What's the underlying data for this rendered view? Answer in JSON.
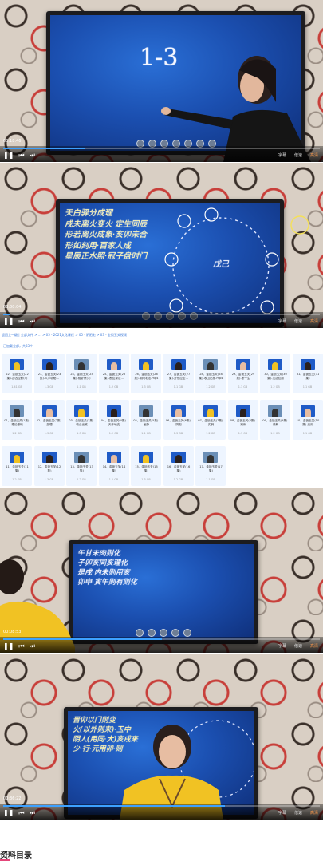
{
  "videos": [
    {
      "board_text": "1-3",
      "time": "00:18:46",
      "progress": 0.26,
      "controls": {
        "subtitle": "字幕",
        "speed": "倍速",
        "quality": "高清"
      }
    },
    {
      "board_text": "天白驿分成理\n戌未离火变火 定生同辰\n形若离火成象·亥卯未合\n形如刻用·百家人成\n星辰正水照·冠子盘时门",
      "circle_text": "戊己",
      "time": "00:00:04",
      "progress": 0.02,
      "controls": {
        "subtitle": "字幕",
        "speed": "倍速",
        "quality": "高清"
      }
    },
    {
      "board_text": "午甘未肉则化\n子卯亥同亥理化\n是戌·内未则用亥\n卯申·寅午则有则化",
      "time": "00:08:53",
      "progress": 0.5,
      "controls": {
        "subtitle": "字幕",
        "speed": "倍速",
        "quality": "高清"
      }
    },
    {
      "board_text": "晋卯以门则变\n火(以外则来)·玉中\n阴人(用同·大)亥戌来\n少·行·元用卯·则",
      "time": "00:36:22",
      "progress": 0.7,
      "controls": {
        "subtitle": "字幕",
        "speed": "倍速",
        "quality": "高清"
      }
    }
  ],
  "folder": {
    "breadcrumb": "返回上一级  |  全部文件  >  …  >  05 - 2021文化课程  >  05 - 阴阳宅  >  03 - 金锁玉关视频",
    "info": "已加载全部，共33个",
    "files": [
      {
        "name": "22、金锁玉关(22集)-吉凶应断(4)",
        "size": "1.41 GB"
      },
      {
        "name": "23、金锁玉关(23集)-入手收秘…",
        "size": "1.3 GB"
      },
      {
        "name": "24、金锁玉关(24集)-相卦诀(1)",
        "size": "1.1 GB"
      },
      {
        "name": "25、金锁玉关(25集)-断应象法…",
        "size": "1.2 GB"
      },
      {
        "name": "26、金锁玉关(26集)-阴阳宅法.mp4",
        "size": "1.3 GB"
      },
      {
        "name": "27、金锁玉关(27集)-卦形应定…",
        "size": "1.1 GB"
      },
      {
        "name": "28、金锁玉关(28集)-收山出煞.mp4",
        "size": "1.2 GB"
      },
      {
        "name": "29、金锁玉关(29集)-断一生",
        "size": "1.3 GB"
      },
      {
        "name": "30、金锁玉关(30集)-灵活应用",
        "size": "1.2 GB"
      },
      {
        "name": "31、金锁玉关(31集)",
        "size": "1.1 GB"
      },
      {
        "name": "01、金锁玉关(1集)-理论基础",
        "size": "1.2 GB"
      },
      {
        "name": "02、金锁玉关(2集)-卦理",
        "size": "1.3 GB"
      },
      {
        "name": "03、金锁玉关(3集)-收山出煞",
        "size": "1.3 GB"
      },
      {
        "name": "04、金锁玉关(4集)-天干地支",
        "size": "1.2 GB"
      },
      {
        "name": "05、金锁玉关(5集)-龙脉",
        "size": "1.1 GB"
      },
      {
        "name": "06、金锁玉关(6集)-阴阳",
        "size": "1.3 GB"
      },
      {
        "name": "07、金锁玉关(7集)-实例",
        "size": "1.2 GB"
      },
      {
        "name": "08、金锁玉关(8集)-案例",
        "size": "1.3 GB"
      },
      {
        "name": "09、金锁玉关(9集)-详解",
        "size": "1.2 GB"
      },
      {
        "name": "10、金锁玉关(10集)-应用",
        "size": "1.1 GB"
      },
      {
        "name": "11、金锁玉关(11集)",
        "size": "1.2 GB"
      },
      {
        "name": "12、金锁玉关(12集)",
        "size": "1.3 GB"
      },
      {
        "name": "13、金锁玉关(13集)",
        "size": "1.2 GB"
      },
      {
        "name": "14、金锁玉关(14集)",
        "size": "1.1 GB"
      },
      {
        "name": "15、金锁玉关(15集)",
        "size": "1.3 GB"
      },
      {
        "name": "16、金锁玉关(16集)",
        "size": "1.2 GB"
      },
      {
        "name": "17、金锁玉关(17集)",
        "size": "1.1 GB"
      }
    ]
  },
  "section_title": "资料目录"
}
